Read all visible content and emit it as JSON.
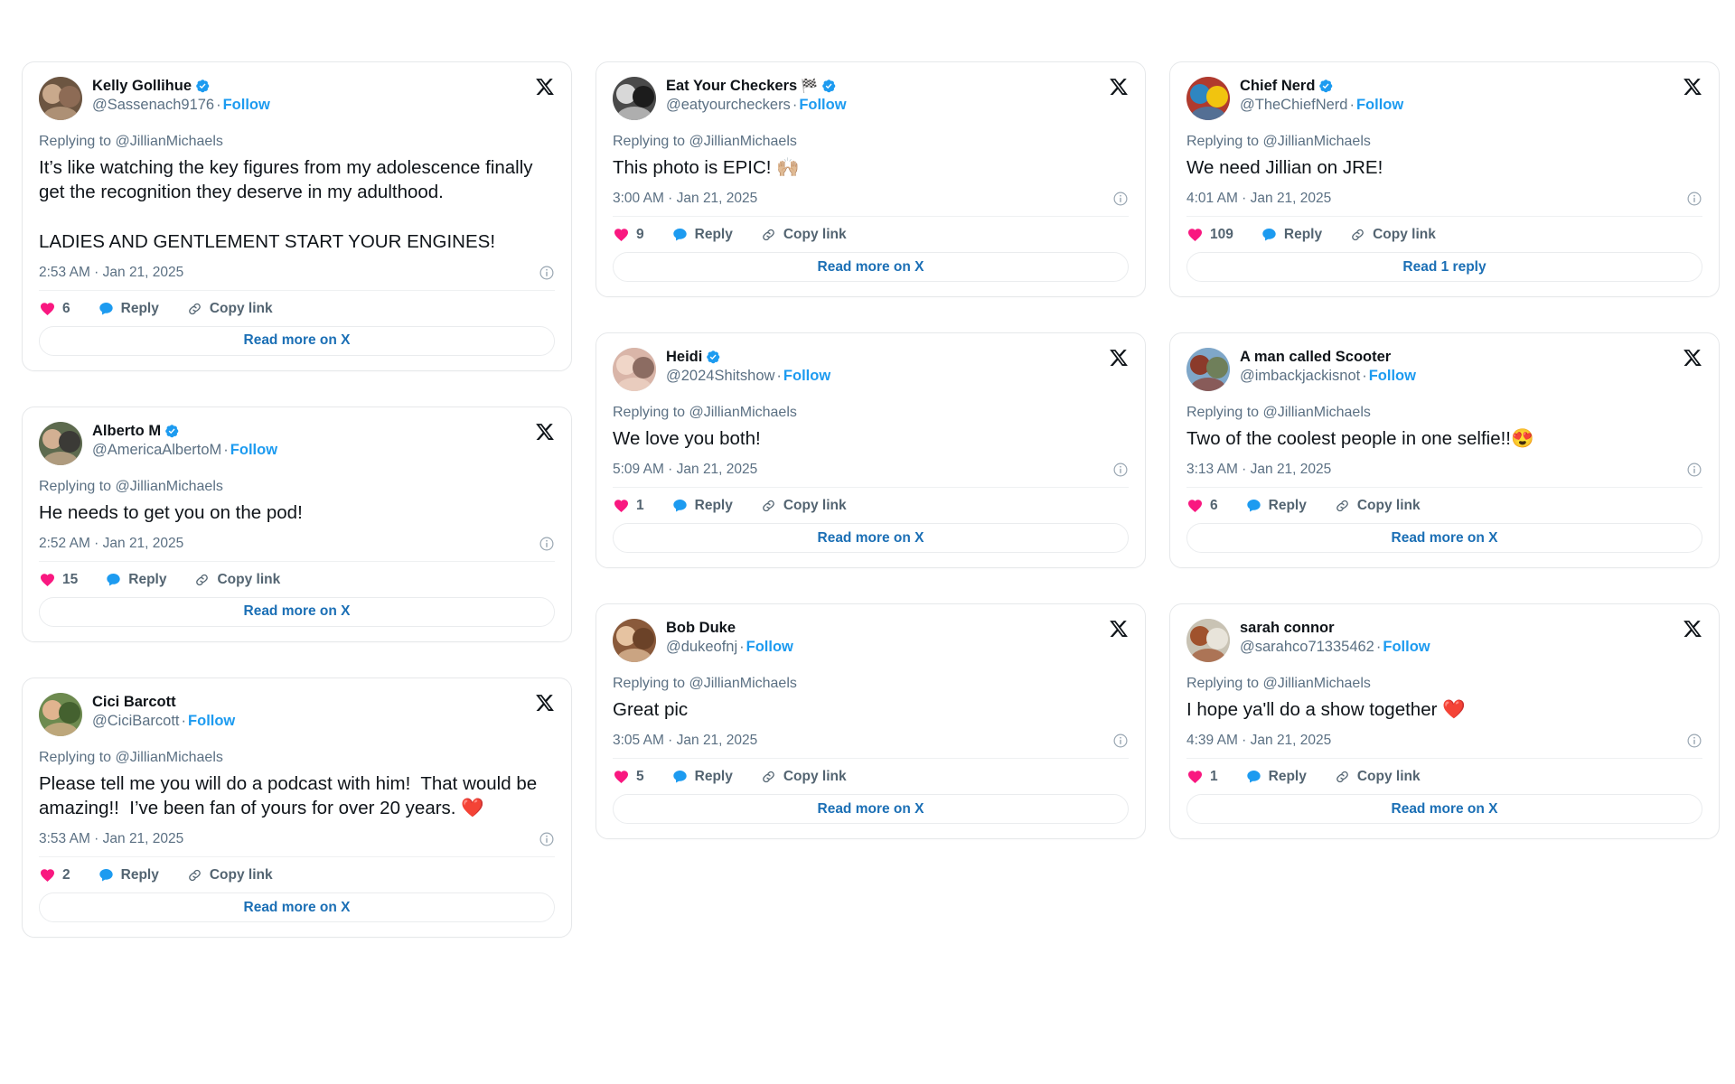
{
  "meta": {
    "accent": "#1d9bf0",
    "like_color": "#f91880",
    "text_color": "#0f1419",
    "muted_color": "#5b7083",
    "link_color": "#1b6fb5",
    "card_border": "#e6e8ea"
  },
  "labels": {
    "replying_to": "Replying to @JillianMichaels",
    "follow": "Follow",
    "reply": "Reply",
    "copy_link": "Copy link",
    "read_more": "Read more on X",
    "dot": "·"
  },
  "icons": {
    "x_logo": "x-logo-icon",
    "verified": "verified-badge-icon",
    "info": "info-icon",
    "like": "heart-icon",
    "reply": "speech-bubble-icon",
    "copy": "link-chain-icon"
  },
  "columns": [
    {
      "id": "column-1",
      "cards": [
        {
          "name": "Kelly Gollihue",
          "name_flag": "",
          "verified": true,
          "handle": "@Sassenach9176",
          "replying_to": "Replying to @JillianMichaels",
          "text": "It’s like watching the key figures from my adolescence finally get the recognition they deserve in my adulthood.\n\nLADIES AND GENTLEMENT START YOUR ENGINES!",
          "timestamp": "2:53 AM · Jan 21, 2025",
          "likes": "6",
          "read_more": "Read more on X",
          "avatar_colors": [
            "#6c5541",
            "#c9a98c",
            "#8d6b55"
          ]
        },
        {
          "name": "Alberto M",
          "name_flag": "",
          "verified": true,
          "handle": "@AmericaAlbertoM",
          "replying_to": "Replying to @JillianMichaels",
          "text": "He needs to get you on the pod!",
          "timestamp": "2:52 AM · Jan 21, 2025",
          "likes": "15",
          "read_more": "Read more on X",
          "avatar_colors": [
            "#5d6a4e",
            "#d3b093",
            "#3b3a36"
          ]
        },
        {
          "name": "Cici Barcott",
          "name_flag": "",
          "verified": false,
          "handle": "@CiciBarcott",
          "replying_to": "Replying to @JillianMichaels",
          "text": "Please tell me you will do a podcast with him!  That would be amazing!!  I’ve been fan of yours for over 20 years. ❤️",
          "timestamp": "3:53 AM · Jan 21, 2025",
          "likes": "2",
          "read_more": "Read more on X",
          "avatar_colors": [
            "#6d8a4f",
            "#e0b48f",
            "#44612f"
          ]
        }
      ]
    },
    {
      "id": "column-2",
      "cards": [
        {
          "name": "Eat Your Checkers",
          "name_flag": "🏁",
          "verified": true,
          "handle": "@eatyourcheckers",
          "replying_to": "Replying to @JillianMichaels",
          "text": "This photo is EPIC! 🙌🏼",
          "timestamp": "3:00 AM · Jan 21, 2025",
          "likes": "9",
          "read_more": "Read more on X",
          "avatar_colors": [
            "#4a4a4a",
            "#d8d8d8",
            "#1c1c1c"
          ]
        },
        {
          "name": "Heidi",
          "name_flag": "",
          "verified": true,
          "handle": "@2024Shitshow",
          "replying_to": "Replying to @JillianMichaels",
          "text": "We love you both!",
          "timestamp": "5:09 AM · Jan 21, 2025",
          "likes": "1",
          "read_more": "Read more on X",
          "avatar_colors": [
            "#d9b5a8",
            "#f0d6c8",
            "#8c6c62"
          ]
        },
        {
          "name": "Bob Duke",
          "name_flag": "",
          "verified": false,
          "handle": "@dukeofnj",
          "replying_to": "Replying to @JillianMichaels",
          "text": "Great pic",
          "timestamp": "3:05 AM · Jan 21, 2025",
          "likes": "5",
          "read_more": "Read more on X",
          "avatar_colors": [
            "#8a5a3b",
            "#e6c3a1",
            "#6b4228"
          ]
        }
      ]
    },
    {
      "id": "column-3",
      "cards": [
        {
          "name": "Chief Nerd",
          "name_flag": "",
          "verified": true,
          "handle": "@TheChiefNerd",
          "replying_to": "Replying to @JillianMichaels",
          "text": "We need Jillian on JRE!",
          "timestamp": "4:01 AM · Jan 21, 2025",
          "likes": "109",
          "read_more": "Read 1 reply",
          "avatar_colors": [
            "#b03a2e",
            "#2e86c1",
            "#f1c40f"
          ]
        },
        {
          "name": "A man called Scooter",
          "name_flag": "",
          "verified": false,
          "handle": "@imbackjackisnot",
          "replying_to": "Replying to @JillianMichaels",
          "text": "Two of the coolest people in one selfie!!😍",
          "timestamp": "3:13 AM · Jan 21, 2025",
          "likes": "6",
          "read_more": "Read more on X",
          "avatar_colors": [
            "#7fa7c9",
            "#8b3a2a",
            "#6f7f5a"
          ]
        },
        {
          "name": "sarah connor",
          "name_flag": "",
          "verified": false,
          "handle": "@sarahco71335462",
          "replying_to": "Replying to @JillianMichaels",
          "text": "I hope ya'll do a show together ❤️",
          "timestamp": "4:39 AM · Jan 21, 2025",
          "likes": "1",
          "read_more": "Read more on X",
          "avatar_colors": [
            "#c9c3b4",
            "#a0522d",
            "#e8e4da"
          ]
        }
      ]
    }
  ]
}
